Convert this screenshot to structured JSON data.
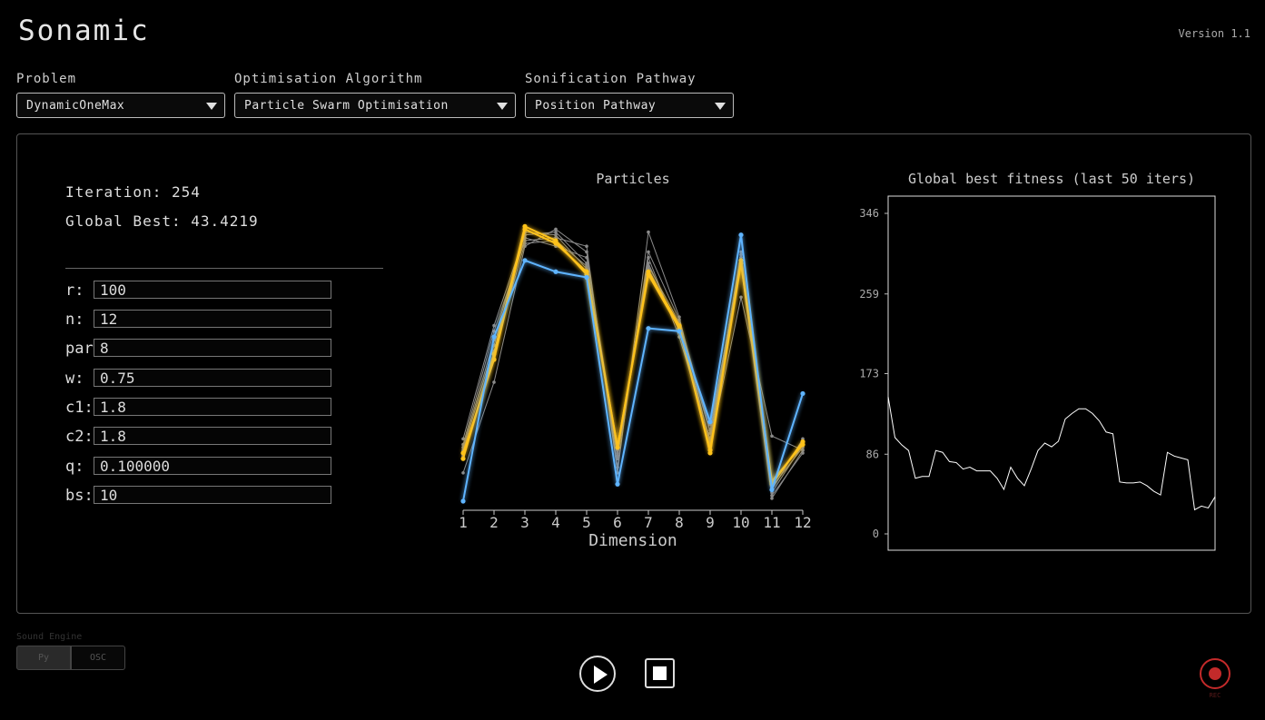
{
  "app": {
    "title": "Sonamic",
    "version": "Version 1.1"
  },
  "selectors": {
    "problem": {
      "label": "Problem",
      "value": "DynamicOneMax"
    },
    "algorithm": {
      "label": "Optimisation Algorithm",
      "value": "Particle Swarm Optimisation"
    },
    "pathway": {
      "label": "Sonification Pathway",
      "value": "Position Pathway"
    }
  },
  "stats": {
    "iteration": "Iteration: 254",
    "global_best": "Global Best: 43.4219"
  },
  "params": [
    {
      "label": "r:",
      "value": "100"
    },
    {
      "label": "n:",
      "value": "12"
    },
    {
      "label": "par",
      "value": "8"
    },
    {
      "label": "w:",
      "value": "0.75"
    },
    {
      "label": "c1:",
      "value": "1.8"
    },
    {
      "label": "c2:",
      "value": "1.8"
    },
    {
      "label": "q:",
      "value": "0.100000"
    },
    {
      "label": "bs:",
      "value": "10"
    }
  ],
  "sound_engine": {
    "label": "Sound Engine",
    "options": [
      "Py",
      "OSC"
    ],
    "selected": "Py"
  },
  "controls": {
    "rec_label": "REC"
  },
  "colors": {
    "highlight_blue": "#5fb4ff",
    "highlight_yellow": "#ffc21a",
    "particle_grey": "#8a8a8a",
    "record_red": "#c32a2a"
  },
  "chart_data": [
    {
      "type": "line",
      "title": "Particles",
      "xlabel": "Dimension",
      "ylabel": "",
      "categories": [
        "1",
        "2",
        "3",
        "4",
        "5",
        "6",
        "7",
        "8",
        "9",
        "10",
        "11",
        "12"
      ],
      "ylim": [
        0,
        1
      ],
      "series": [
        {
          "color": "#5fb4ff",
          "values": [
            0.0,
            0.58,
            0.85,
            0.81,
            0.79,
            0.06,
            0.61,
            0.6,
            0.28,
            0.94,
            0.04,
            0.38
          ]
        },
        {
          "color": "#ffc21a",
          "values": [
            0.15,
            0.52,
            0.97,
            0.92,
            0.8,
            0.19,
            0.81,
            0.62,
            0.17,
            0.84,
            0.06,
            0.21
          ]
        },
        {
          "color": "#ffc21a",
          "values": [
            0.17,
            0.5,
            0.96,
            0.91,
            0.81,
            0.19,
            0.8,
            0.61,
            0.18,
            0.85,
            0.07,
            0.2
          ]
        },
        {
          "color": "#8a8a8a",
          "values": [
            0.2,
            0.6,
            0.92,
            0.93,
            0.9,
            0.1,
            0.95,
            0.65,
            0.2,
            0.72,
            0.23,
            0.18
          ]
        },
        {
          "color": "#8a8a8a",
          "values": [
            0.1,
            0.42,
            0.9,
            0.96,
            0.88,
            0.12,
            0.88,
            0.64,
            0.25,
            0.86,
            0.02,
            0.17
          ]
        },
        {
          "color": "#8a8a8a",
          "values": [
            0.22,
            0.62,
            0.94,
            0.95,
            0.84,
            0.15,
            0.86,
            0.58,
            0.22,
            0.88,
            0.05,
            0.19
          ]
        },
        {
          "color": "#8a8a8a",
          "values": [
            0.18,
            0.55,
            0.93,
            0.9,
            0.86,
            0.18,
            0.84,
            0.6,
            0.27,
            0.83,
            0.01,
            0.18
          ]
        },
        {
          "color": "#8a8a8a",
          "values": [
            0.19,
            0.57,
            0.95,
            0.94,
            0.82,
            0.17,
            0.83,
            0.63,
            0.24,
            0.87,
            0.03,
            0.2
          ]
        },
        {
          "color": "#8a8a8a",
          "values": [
            0.16,
            0.53,
            0.91,
            0.92,
            0.83,
            0.16,
            0.82,
            0.61,
            0.21,
            0.86,
            0.04,
            0.22
          ]
        }
      ]
    },
    {
      "type": "line",
      "title": "Global best fitness (last 50 iters)",
      "xlabel": "",
      "ylabel": "",
      "yticks": [
        0,
        86,
        173,
        259,
        346
      ],
      "ylim": [
        0,
        346
      ],
      "series": [
        {
          "color": "#ffffff",
          "values": [
            148,
            104,
            96,
            90,
            60,
            62,
            62,
            90,
            88,
            78,
            77,
            70,
            72,
            68,
            68,
            68,
            60,
            48,
            72,
            60,
            52,
            70,
            90,
            98,
            94,
            100,
            124,
            130,
            135,
            135,
            130,
            122,
            110,
            108,
            56,
            55,
            55,
            56,
            52,
            46,
            42,
            88,
            84,
            82,
            80,
            26,
            30,
            28,
            40
          ]
        }
      ]
    }
  ]
}
